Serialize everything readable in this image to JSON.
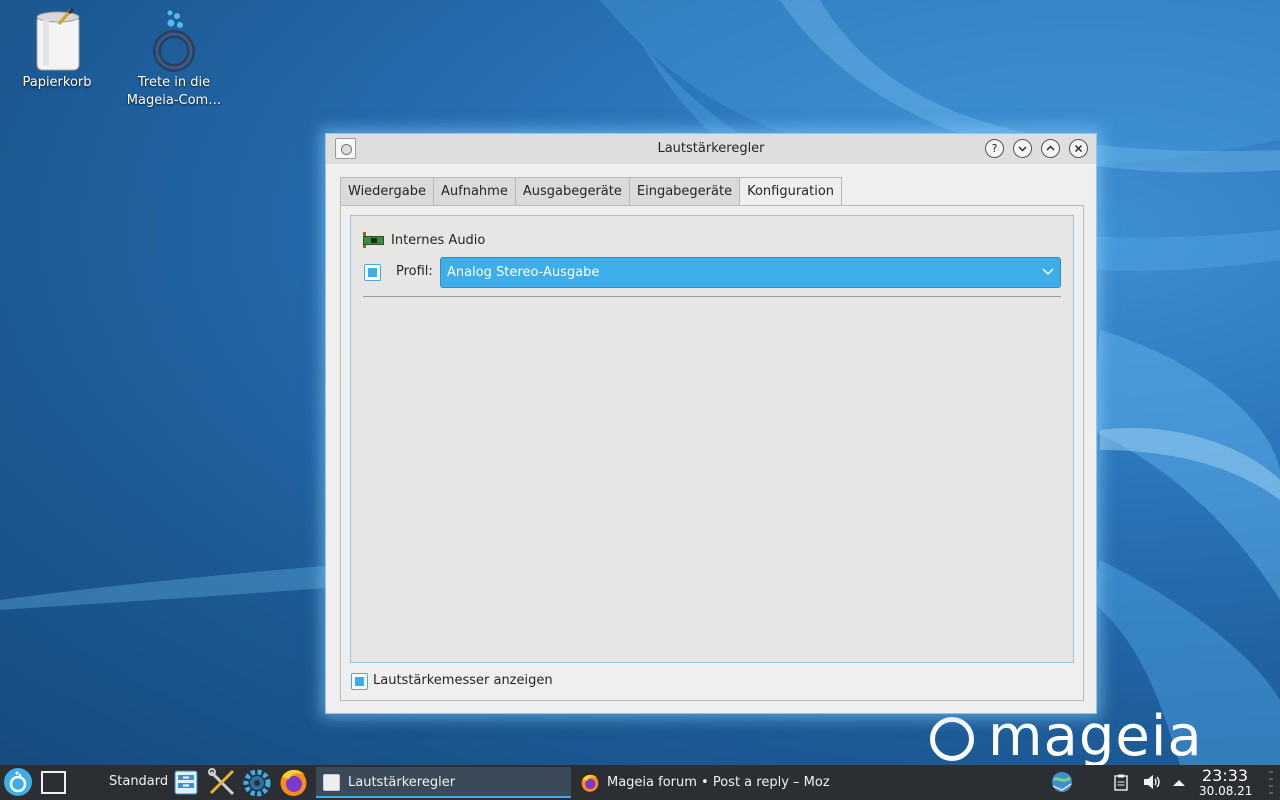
{
  "desktop": {
    "icons": [
      {
        "label": "Papierkorb",
        "icon": "trash-icon"
      },
      {
        "label": "Trete in die Mageia-Com…",
        "icon": "mageia-community-icon"
      }
    ],
    "brand": "mageia"
  },
  "dialog": {
    "title": "Lautstärkeregler",
    "title_buttons": [
      "help-icon",
      "minimize-icon",
      "maximize-icon",
      "close-icon"
    ],
    "tabs": [
      {
        "label": "Wiedergabe",
        "active": false
      },
      {
        "label": "Aufnahme",
        "active": false
      },
      {
        "label": "Ausgabegeräte",
        "active": false
      },
      {
        "label": "Eingabegeräte",
        "active": false
      },
      {
        "label": "Konfiguration",
        "active": true
      }
    ],
    "card": {
      "name": "Internes Audio",
      "icon": "sound-card-icon",
      "profile_checked": true,
      "profile_label": "Profil:",
      "profile_value": "Analog Stereo-Ausgabe"
    },
    "meter": {
      "label": "Lautstärkemesser anzeigen",
      "checked": true
    }
  },
  "taskbar": {
    "activity": "Standard",
    "launchers": [
      "application-launcher-icon",
      "show-desktop-icon",
      "file-manager-icon",
      "system-tools-icon",
      "settings-gear-icon",
      "firefox-icon"
    ],
    "tasks": [
      {
        "label": "Lautstärkeregler",
        "active": true
      },
      {
        "label": "Mageia forum • Post a reply – Moz…",
        "active": false
      }
    ],
    "tray": [
      "network-icon",
      "clipboard-icon",
      "volume-icon",
      "tray-expand-icon"
    ],
    "clock": {
      "time": "23:33",
      "date": "30.08.21"
    }
  },
  "colors": {
    "accent": "#3daee9",
    "taskbar": "#2b2f33",
    "window": "#efefef"
  }
}
